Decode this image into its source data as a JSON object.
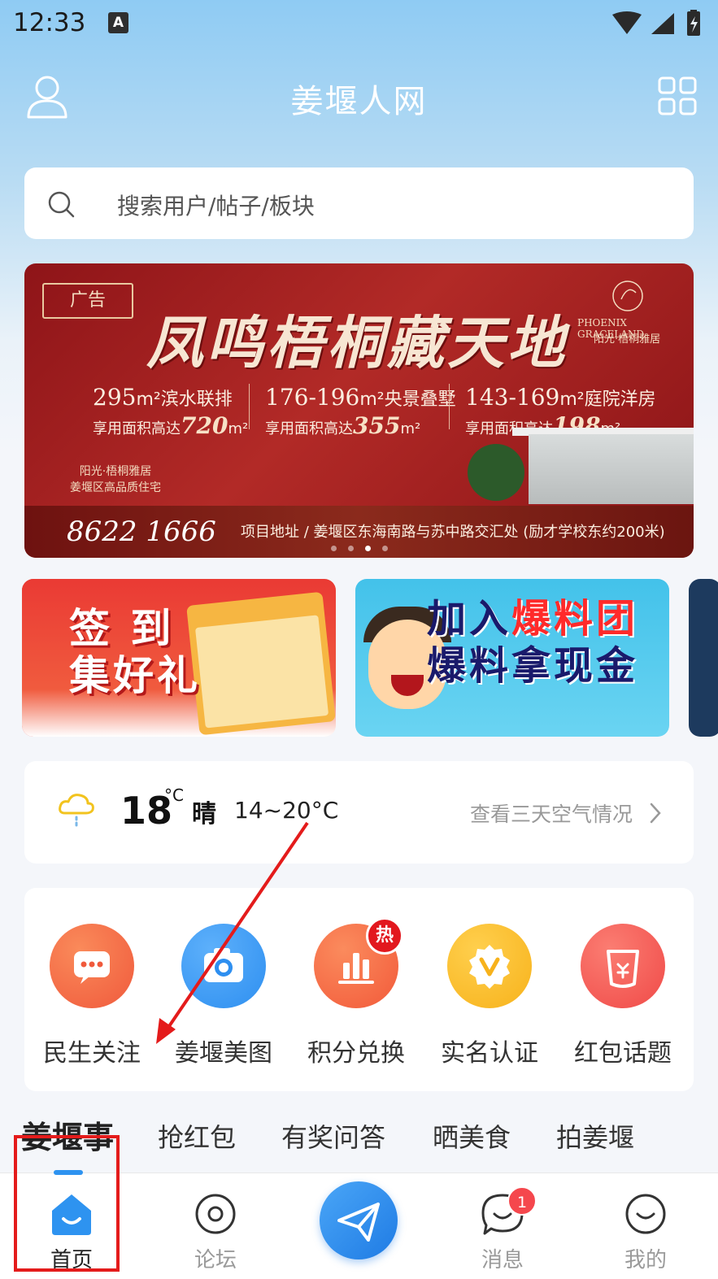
{
  "status_bar": {
    "time": "12:33",
    "notification_glyph": "A"
  },
  "app_bar": {
    "title": "姜堰人网"
  },
  "search": {
    "placeholder": "搜索用户/帖子/板块"
  },
  "banner": {
    "ad_tag": "广告",
    "headline": "凤鸣梧桐藏天地",
    "brand_en": "PHOENIX GRACELAND",
    "brand_cn": "阳光·梧桐雅居",
    "specs": [
      {
        "area": "295",
        "unit": "m²",
        "type": "滨水联排",
        "sub_label": "享用面积高达",
        "sub_area": "720",
        "sub_unit": "m²"
      },
      {
        "area": "176-196",
        "unit": "m²",
        "type": "央景叠墅",
        "sub_label": "享用面积高达",
        "sub_area": "355",
        "sub_unit": "m²"
      },
      {
        "area": "143-169",
        "unit": "m²",
        "type": "庭院洋房",
        "sub_label": "享用面积高达",
        "sub_area": "198",
        "sub_unit": "m²"
      }
    ],
    "sub_brand_line1": "阳光·梧桐雅居",
    "sub_brand_line2": "姜堰区高品质住宅",
    "phone": "8622 1666",
    "address": "项目地址 /  姜堰区东海南路与苏中路交汇处 (励才学校东约200米)",
    "active_slide": 3,
    "slide_count": 4
  },
  "promos": [
    {
      "title_line1": "签 到",
      "title_line2": "集好礼"
    },
    {
      "title_line1_a": "加入",
      "title_line1_b": "爆料团",
      "title_line2": "爆料拿现金"
    }
  ],
  "weather": {
    "temp": "18",
    "unit": "°C",
    "condition": "晴",
    "range": "14~20°C",
    "link": "查看三天空气情况"
  },
  "quick_actions": [
    {
      "label": "民生关注",
      "icon": "chat-dots-icon",
      "color": "#f05a3c"
    },
    {
      "label": "姜堰美图",
      "icon": "camera-icon",
      "color": "#2e8ff0"
    },
    {
      "label": "积分兑换",
      "icon": "bar-chart-icon",
      "color": "#f25a3a",
      "badge": "热"
    },
    {
      "label": "实名认证",
      "icon": "verified-v-icon",
      "color": "#f7b21b"
    },
    {
      "label": "红包话题",
      "icon": "red-packet-icon",
      "color": "#f04a48"
    }
  ],
  "tabs": [
    "姜堰事",
    "抢红包",
    "有奖问答",
    "晒美食",
    "拍姜堰"
  ],
  "bottom_nav": {
    "items": [
      {
        "label": "首页",
        "icon": "home-icon",
        "active": true
      },
      {
        "label": "论坛",
        "icon": "forum-icon",
        "active": false
      },
      {
        "label": "消息",
        "icon": "message-icon",
        "active": false,
        "badge": "1"
      },
      {
        "label": "我的",
        "icon": "profile-smile-icon",
        "active": false
      }
    ],
    "center_icon": "send-plane-icon"
  },
  "colors": {
    "accent": "#2e93f0",
    "annotation": "#e41b1b",
    "banner_red": "#b22a27"
  }
}
